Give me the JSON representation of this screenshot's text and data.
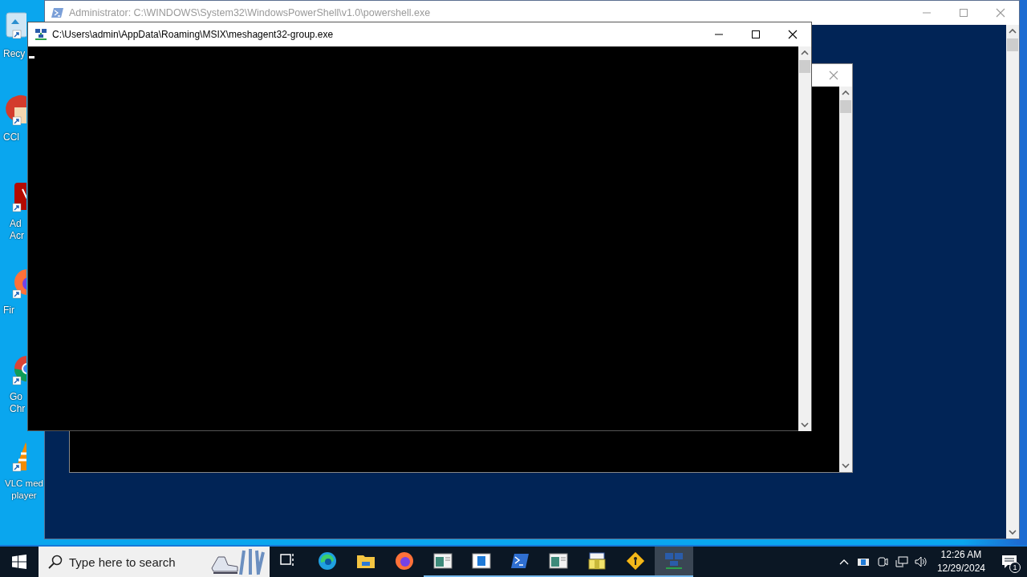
{
  "desktop_icons": [
    {
      "kind": "recycle",
      "lines": [
        "Recy"
      ]
    },
    {
      "kind": "ccleaner",
      "lines": [
        "CCl"
      ]
    },
    {
      "kind": "acrobat",
      "lines": [
        "Ad",
        "Acr"
      ]
    },
    {
      "kind": "firefox",
      "lines": [
        "Fir"
      ]
    },
    {
      "kind": "chrome",
      "lines": [
        "Go",
        "Chr"
      ]
    },
    {
      "kind": "vlc",
      "lines": [
        "VLC med",
        "player"
      ]
    }
  ],
  "windows": [
    {
      "kind": "powershell",
      "title": "Administrator: C:\\WINDOWS\\System32\\WindowsPowerShell\\v1.0\\powershell.exe",
      "active": false
    },
    {
      "kind": "dialog",
      "active": false
    },
    {
      "kind": "console",
      "title": "C:\\Users\\admin\\AppData\\Roaming\\MSIX\\meshagent32-group.exe",
      "active": true,
      "cursor_visible": true
    }
  ],
  "taskbar": {
    "search": {
      "placeholder": "Type here to search"
    },
    "apps": [
      {
        "kind": "taskview",
        "running": false,
        "selected": false
      },
      {
        "kind": "edge",
        "running": false,
        "selected": false
      },
      {
        "kind": "explorer",
        "running": false,
        "selected": false
      },
      {
        "kind": "firefox",
        "running": false,
        "selected": false
      },
      {
        "kind": "window",
        "running": true,
        "selected": false
      },
      {
        "kind": "panel",
        "running": true,
        "selected": false
      },
      {
        "kind": "powershell",
        "running": true,
        "selected": false
      },
      {
        "kind": "window",
        "running": true,
        "selected": false
      },
      {
        "kind": "installer",
        "running": true,
        "selected": false
      },
      {
        "kind": "diamond",
        "running": true,
        "selected": false
      },
      {
        "kind": "network",
        "running": true,
        "selected": true
      }
    ],
    "tray": {
      "time": "12:26 AM",
      "date": "12/29/2024",
      "notifications": "1"
    }
  }
}
